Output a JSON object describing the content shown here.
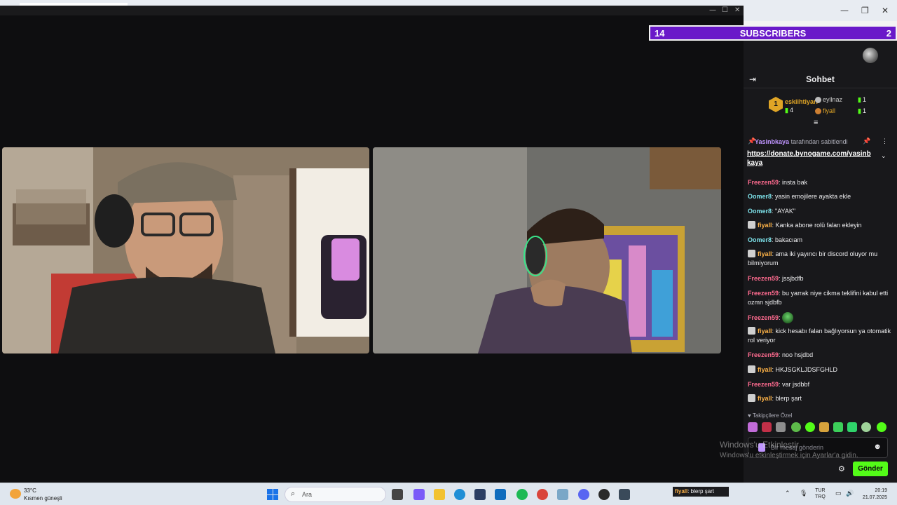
{
  "subscribers": {
    "left_count": "14",
    "title": "SUBSCRIBERS",
    "right_count": "2"
  },
  "chat": {
    "title": "Sohbet",
    "leaderboard": [
      {
        "rank": "1",
        "name": "eskiihtiyarr",
        "count": "4"
      },
      {
        "name": "eyllnaz",
        "count": "1"
      },
      {
        "name": "fiyall",
        "count": "1"
      }
    ],
    "pinned": {
      "user": "Yasinbkaya",
      "suffix": "tarafından sabitlendi",
      "link": "https://donate.bynogame.com/yasinbkaya"
    },
    "messages": [
      {
        "user": "Freezen59",
        "text": "insta bak",
        "color": "red"
      },
      {
        "user": "Oomer8",
        "text": "yasin emojilere ayakta ekle",
        "color": "cyan"
      },
      {
        "user": "Oomer8",
        "text": "\"AYAK\"",
        "color": "cyan"
      },
      {
        "user": "fiyall",
        "text": "Kanka abone rolü falan ekleyin",
        "color": "orange"
      },
      {
        "user": "Oomer8",
        "text": "bakacıam",
        "color": "cyan"
      },
      {
        "user": "fiyall",
        "text": "ama iki yayıncı bir discord oluyor mu bilmiyorum",
        "color": "orange"
      },
      {
        "user": "Freezen59",
        "text": "jssjbdfb",
        "color": "red"
      },
      {
        "user": "Freezen59",
        "text": "bu yarrak niye cikma teklifini kabul etti ozmn sjdbfb",
        "color": "red"
      },
      {
        "user": "Freezen59",
        "text": "",
        "color": "red",
        "emote": "green-face-emote"
      },
      {
        "user": "fiyall",
        "text": "kick hesabı falan bağlıyorsun ya otomatik rol veriyor",
        "color": "orange"
      },
      {
        "user": "Freezen59",
        "text": "noo hsjdbd",
        "color": "red"
      },
      {
        "user": "fiyall",
        "text": "HKJSGKLJDSFGHLD",
        "color": "orange"
      },
      {
        "user": "Freezen59",
        "text": "var jsdbbf",
        "color": "red"
      },
      {
        "user": "fiyall",
        "text": "blerp şart",
        "color": "orange"
      }
    ],
    "emote_section_label": "Takipçilere Özel",
    "input_placeholder": "Bir mesaj gönderin",
    "send_label": "Gönder"
  },
  "watermark": {
    "line1": "Windows'u Etkinleştir",
    "line2": "Windows'u etkinleştirmek için Ayarlar'a gidin."
  },
  "taskbar": {
    "weather_temp": "33°C",
    "weather_desc": "Kısmen güneşli",
    "search_placeholder": "Ara",
    "notification": {
      "user": "fiyall",
      "text": ": blerp şart"
    },
    "lang_line1": "TUR",
    "lang_line2": "TRQ",
    "time": "20:19",
    "date": "21.07.2025"
  },
  "colors": {
    "kick_green": "#53fc18",
    "subs_purple": "#6a19c9",
    "chat_bg": "#18181b",
    "user_red": "#ff6b8f",
    "user_cyan": "#7de2ea",
    "user_orange": "#ffb347"
  }
}
